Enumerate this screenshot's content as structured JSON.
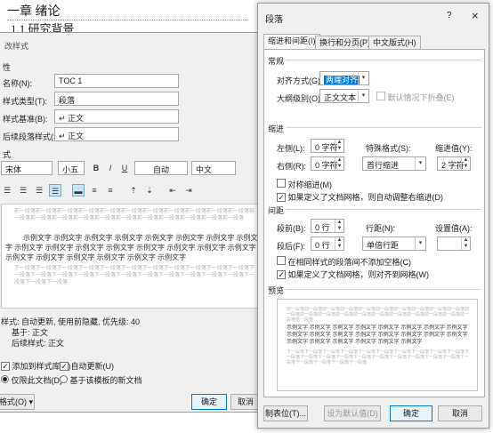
{
  "doc": {
    "heading1": "一章   绪论",
    "heading2": "1.1   研究背景"
  },
  "left_dialog": {
    "title": "改样式",
    "section_props": "性",
    "name_label": "名称(N):",
    "name_value": "TOC 1",
    "type_label": "样式类型(T):",
    "type_value": "段落",
    "based_label": "样式基准(B):",
    "based_value": "↵ 正文",
    "next_label": "后续段落样式(S):",
    "next_value": "↵ 正文",
    "section_format": "式",
    "font_value": "宋体",
    "size_value": "小五",
    "bold": "B",
    "italic": "I",
    "underline": "U",
    "color_value": "自动",
    "lang_value": "中文",
    "preview_prev": "前一段落前一段落前一段落前一段落前一段落前一段落前一段落前一段落前一段落前一段落前一段落前一段落前一段落前一段落前一段落前一段落前一段落前一段落前一段落前一段落前一段落前一段落",
    "preview_sample": "示例文字 示例文字 示例文字 示例文字 示例文字 示例文字 示例文字 示例文字 示例文字 示例文字 示例文字 示例文字 示例文字 示例文字 示例文字 示例文字 示例文字 示例文字 示例文字 示例文字 示例文字 示例文字",
    "preview_next": "下一段落下一段落下一段落下一段落下一段落下一段落下一段落下一段落下一段落下一段落下一段落下一段落下一段落下一段落下一段落下一段落下一段落下一段落下一段落下一段落下一段落下一段落下一段落下一段落下一段落",
    "desc_line1": "样式: 自动更新, 使用前隐藏, 优先级: 40",
    "desc_line2": "基于: 正文",
    "desc_line3": "后续样式: 正文",
    "add_to_gallery": "添加到样式库(S)",
    "auto_update": "自动更新(U)",
    "only_this_doc": "仅限此文档(D)",
    "new_docs": "基于该模板的新文档",
    "format_btn": "格式(O) ▾",
    "ok": "确定",
    "cancel": "取消"
  },
  "right_dialog": {
    "title": "段落",
    "help": "?",
    "close": "×",
    "tabs": [
      "缩进和间距(I)",
      "换行和分页(P)",
      "中文版式(H)"
    ],
    "general": "常规",
    "align_label": "对齐方式(G):",
    "align_value": "两端对齐",
    "outline_label": "大纲级别(O):",
    "outline_value": "正文文本",
    "collapse_label": "默认情况下折叠(E)",
    "indent": "缩进",
    "left_label": "左侧(L):",
    "left_value": "0 字符",
    "right_label": "右侧(R):",
    "right_value": "0 字符",
    "special_label": "特殊格式(S):",
    "special_value": "首行缩进",
    "indent_by_label": "缩进值(Y):",
    "indent_by_value": "2 字符",
    "mirror_label": "对称缩进(M)",
    "auto_adjust_label": "如果定义了文档网格，则自动调整右缩进(D)",
    "spacing": "间距",
    "before_label": "段前(B):",
    "before_value": "0 行",
    "after_label": "段后(F):",
    "after_value": "0 行",
    "line_label": "行距(N):",
    "line_value": "单倍行距",
    "at_label": "设置值(A):",
    "at_value": "",
    "no_space_label": "在相同样式的段落间不添加空格(C)",
    "snap_grid_label": "如果定义了文档网格，则对齐到网格(W)",
    "preview": "预览",
    "tabs_btn": "制表位(T)...",
    "default_btn": "设为默认值(D)",
    "ok": "确定",
    "cancel": "取消"
  }
}
